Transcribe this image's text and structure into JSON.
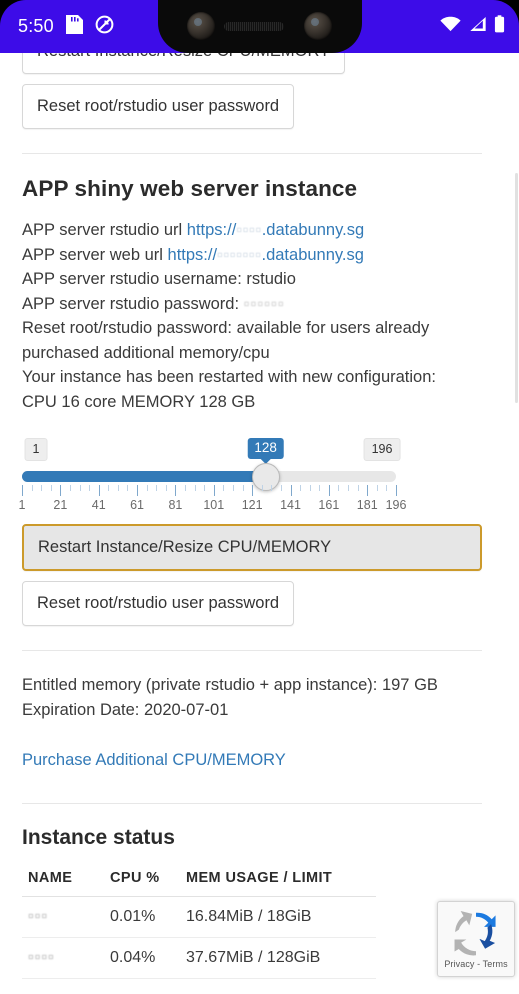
{
  "statusbar": {
    "time": "5:50",
    "icons": [
      "sd-card-icon",
      "do-not-disturb-icon",
      "wifi-icon",
      "cellular-signal-icon",
      "battery-icon"
    ],
    "accent_color": "#3D0CE8"
  },
  "top_partial": {
    "restart_label": "Restart Instance/Resize CPU/MEMORY",
    "reset_password_label": "Reset root/rstudio user password"
  },
  "app_section": {
    "title": "APP shiny web server instance",
    "rstudio_url_prefix": "APP server rstudio url ",
    "rstudio_url_scheme": "https://",
    "rstudio_url_redacted": "▫▫▫▫",
    "rstudio_url_domain": ".databunny.sg",
    "web_url_prefix": "APP server web url ",
    "web_url_scheme": "https://",
    "web_url_redacted": "▫▫▫▫▫▫▫",
    "web_url_domain": ".databunny.sg",
    "username_line": "APP server rstudio username: rstudio",
    "password_prefix": "APP server rstudio password: ",
    "password_redacted": "▫▫▫▫▫▫",
    "reset_note_line1": "Reset root/rstudio password: available for users already",
    "reset_note_line2": "purchased additional memory/cpu",
    "restart_note_line1": "Your instance has been restarted with new configuration:",
    "restart_note_line2": "CPU 16 core MEMORY 128 GB"
  },
  "slider": {
    "min": 1,
    "max": 196,
    "value": 128,
    "min_label": "1",
    "max_label": "196",
    "value_label": "128",
    "tick_labels": [
      "1",
      "21",
      "41",
      "61",
      "81",
      "101",
      "121",
      "141",
      "161",
      "181",
      "196"
    ],
    "tick_values": [
      1,
      21,
      41,
      61,
      81,
      101,
      121,
      141,
      161,
      181,
      196
    ],
    "fill_color": "#337ab7",
    "track_color": "#e7e7e7"
  },
  "actions": {
    "restart_label": "Restart Instance/Resize CPU/MEMORY",
    "reset_password_label": "Reset root/rstudio user password",
    "restart_focus_color": "#cc9a2b"
  },
  "entitlement": {
    "memory_line": "Entitled memory (private rstudio + app instance): 197 GB",
    "expiration_line": "Expiration Date: 2020-07-01",
    "purchase_link": "Purchase Additional CPU/MEMORY",
    "link_color": "#337ab7"
  },
  "instance_status": {
    "title": "Instance status",
    "columns": [
      "NAME",
      "CPU %",
      "MEM USAGE / LIMIT"
    ],
    "rows": [
      {
        "name": "▫▫▫",
        "cpu": "0.01%",
        "mem": "16.84MiB / 18GiB"
      },
      {
        "name": "▫▫▫▫",
        "cpu": "0.04%",
        "mem": "37.67MiB / 128GiB"
      }
    ]
  },
  "recaptcha": {
    "label": "Privacy - Terms",
    "icon": "recaptcha-logo-icon"
  }
}
